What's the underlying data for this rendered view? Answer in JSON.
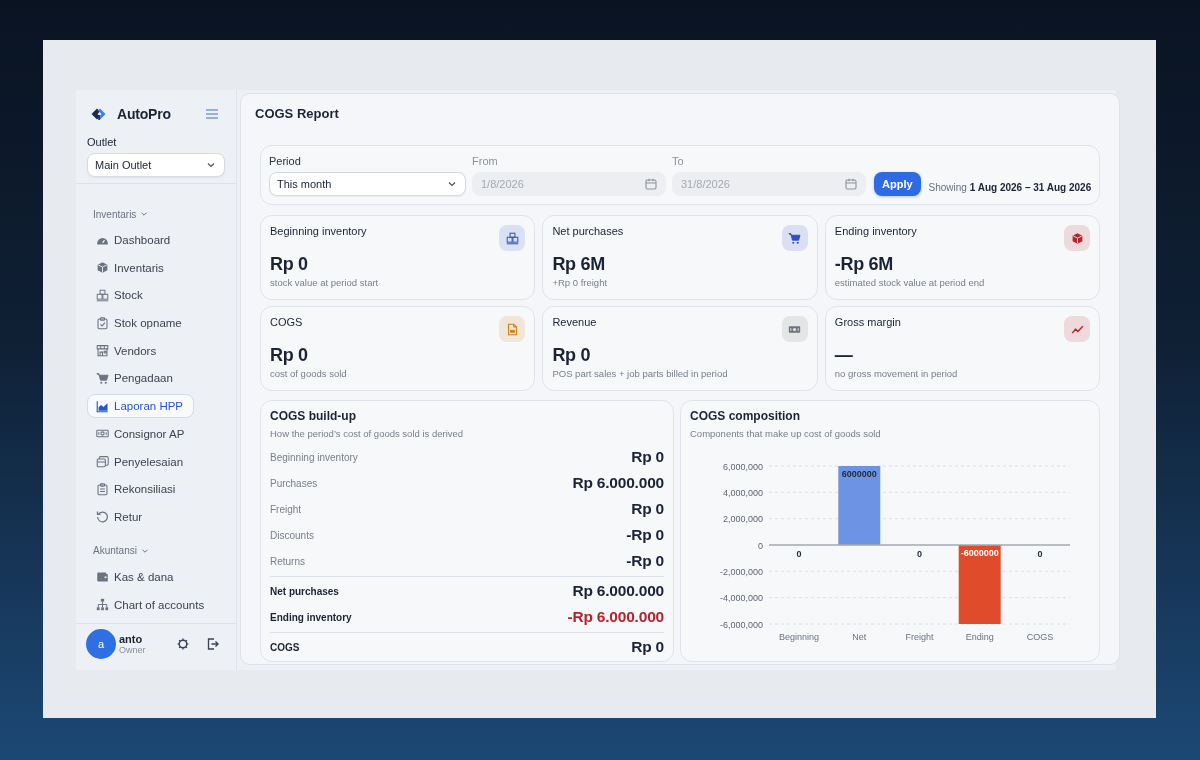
{
  "sidebar": {
    "brand": "AutoPro",
    "outlet": {
      "label": "Outlet",
      "value": "Main Outlet"
    },
    "groups": [
      {
        "label": "Inventaris",
        "expanded": true,
        "items": [
          {
            "label": "Dashboard",
            "selected": false
          },
          {
            "label": "Inventaris",
            "selected": false
          },
          {
            "label": "Stock",
            "selected": false
          },
          {
            "label": "Stok opname",
            "selected": false
          },
          {
            "label": "Vendors",
            "selected": false
          },
          {
            "label": "Pengadaan",
            "selected": false
          },
          {
            "label": "Laporan HPP",
            "selected": true
          },
          {
            "label": "Consignor AP",
            "selected": false
          },
          {
            "label": "Penyelesaian",
            "selected": false
          },
          {
            "label": "Rekonsiliasi",
            "selected": false
          },
          {
            "label": "Retur",
            "selected": false
          }
        ]
      },
      {
        "label": "Akuntansi",
        "expanded": true,
        "items": [
          {
            "label": "Kas & dana",
            "selected": false
          },
          {
            "label": "Chart of accounts",
            "selected": false
          }
        ]
      }
    ],
    "user": {
      "initial": "a",
      "name": "anto",
      "role": "Owner"
    }
  },
  "page": {
    "title": "COGS Report"
  },
  "filters": {
    "period": {
      "label": "Period",
      "value": "This month"
    },
    "from": {
      "label": "From",
      "value": "1/8/2026",
      "disabled": true
    },
    "to": {
      "label": "To",
      "value": "31/8/2026",
      "disabled": true
    },
    "apply": "Apply",
    "showing": "Showing **1 Aug 2026 – 31 Aug 2026**"
  },
  "kpis": [
    {
      "title": "Beginning inventory",
      "value": "Rp 0",
      "note": "stock value at period start",
      "color": "#3456c8"
    },
    {
      "title": "Net purchases",
      "value": "Rp 6M",
      "note": "+Rp 0 freight",
      "color": "#2f4fc4"
    },
    {
      "title": "Ending inventory",
      "value": "-Rp 6M",
      "note": "estimated stock value at period end",
      "color": "#b3262d"
    },
    {
      "title": "COGS",
      "value": "Rp 0",
      "note": "cost of goods sold",
      "color": "#d0801a"
    },
    {
      "title": "Revenue",
      "value": "Rp 0",
      "note": "POS part sales + job parts billed in period",
      "color": "#6e737b"
    },
    {
      "title": "Gross margin",
      "value": "—",
      "note": "no gross movement in period",
      "color": "#c0262d"
    }
  ],
  "buildup": {
    "title": "COGS build-up",
    "subtitle": "How the period’s cost of goods sold is derived",
    "rows": [
      {
        "kind": "line",
        "label": "Beginning inventory",
        "value": "Rp 0",
        "highlight": false
      },
      {
        "kind": "line",
        "label": "Purchases",
        "value": "Rp 6.000.000",
        "highlight": false
      },
      {
        "kind": "line",
        "label": "Freight",
        "value": "Rp 0",
        "highlight": false
      },
      {
        "kind": "line",
        "label": "Discounts",
        "value": "-Rp 0",
        "highlight": false
      },
      {
        "kind": "line",
        "label": "Returns",
        "value": "-Rp 0",
        "highlight": false
      },
      {
        "kind": "subtotal",
        "label": "Net purchases",
        "value": "Rp 6.000.000",
        "highlight": false
      },
      {
        "kind": "subtotal",
        "label": "Ending inventory",
        "value": "-Rp 6.000.000",
        "highlight": true
      },
      {
        "kind": "total",
        "label": "COGS",
        "value": "Rp 0",
        "highlight": false
      }
    ]
  },
  "composition": {
    "title": "COGS composition",
    "subtitle": "Components that make up cost of goods sold",
    "chart_data": {
      "type": "bar",
      "categories": [
        "Beginning",
        "Net",
        "Freight",
        "Ending",
        "COGS"
      ],
      "series": [
        {
          "color": "#6d94e4",
          "values": [
            0,
            6000000,
            0,
            null,
            0
          ]
        },
        {
          "color": "#e04b2c",
          "values": [
            null,
            null,
            null,
            -6000000,
            null
          ]
        }
      ],
      "stacked": true,
      "grid": true,
      "ylim": [
        -6000000,
        6000000
      ],
      "yticks": [
        {
          "value": 6000000,
          "label": "6,000,000"
        },
        {
          "value": 4000000,
          "label": "4,000,000"
        },
        {
          "value": 2000000,
          "label": "2,000,000"
        },
        {
          "value": 0,
          "label": "0"
        },
        {
          "value": -2000000,
          "label": "-2,000,000"
        },
        {
          "value": -4000000,
          "label": "-4,000,000"
        },
        {
          "value": -6000000,
          "label": "-6,000,000"
        }
      ],
      "data_labels": true
    }
  }
}
